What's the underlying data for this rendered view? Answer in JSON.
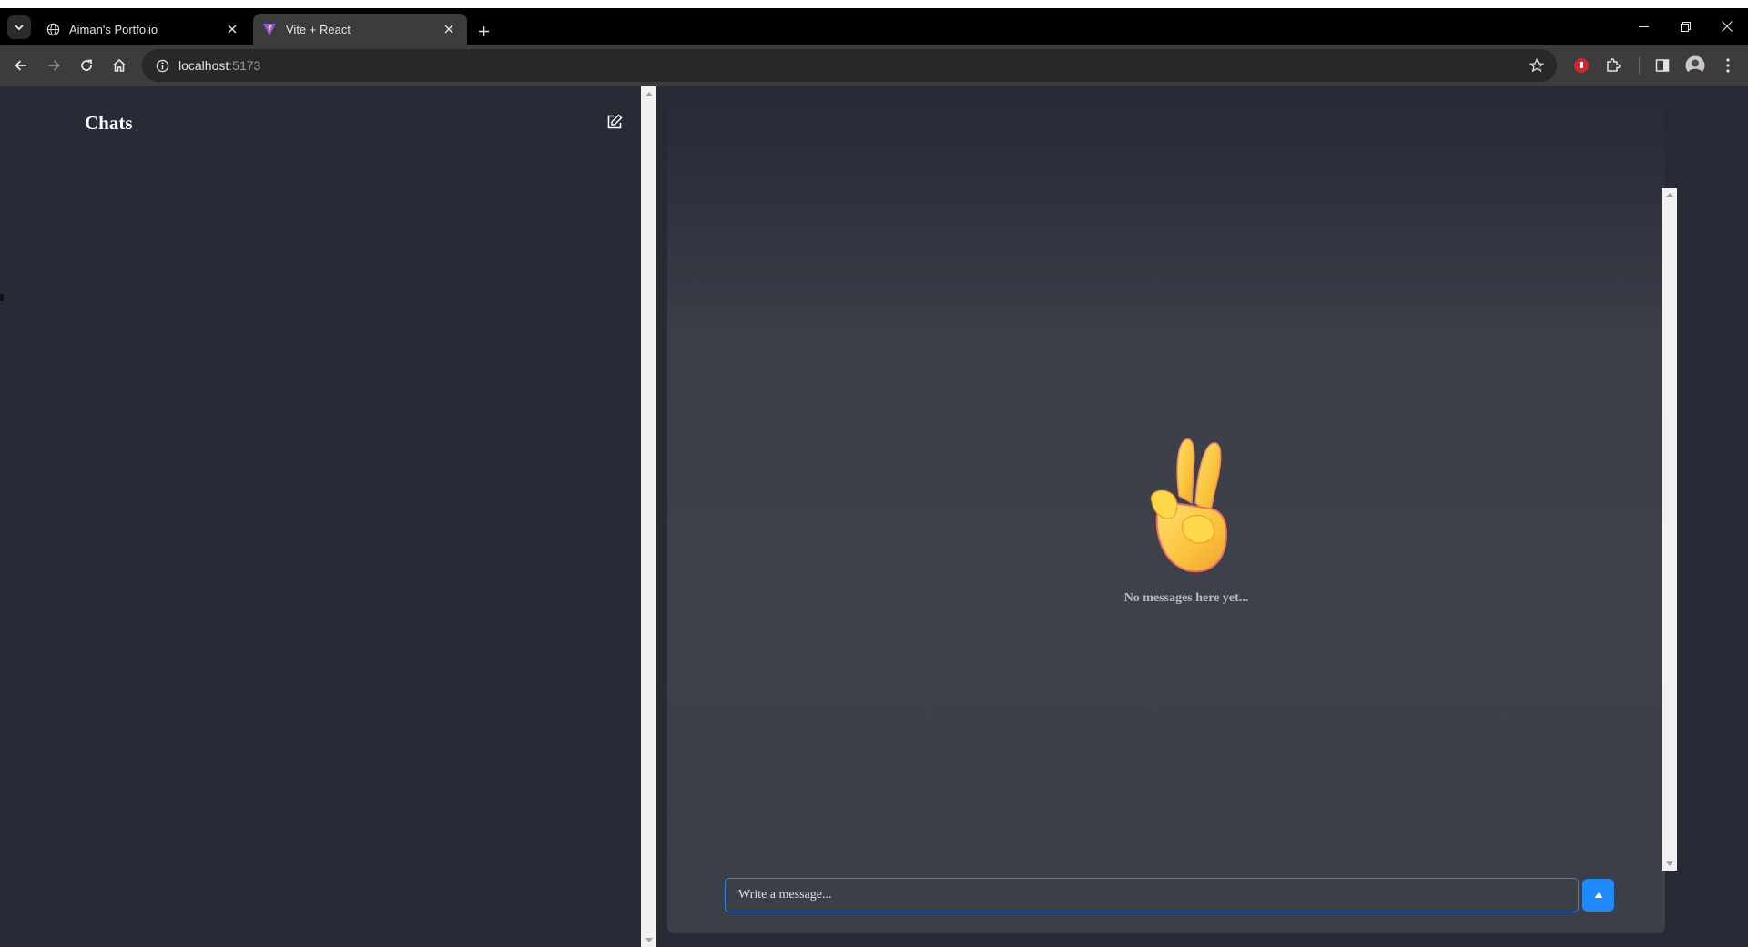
{
  "browser": {
    "tabs": [
      {
        "title": "Aiman's Portfolio",
        "active": false,
        "favicon": "globe-icon"
      },
      {
        "title": "Vite + React",
        "active": true,
        "favicon": "vite-icon"
      }
    ],
    "url": {
      "host": "localhost",
      "port": ":5173"
    }
  },
  "sidebar": {
    "title": "Chats",
    "compose_icon": "edit-icon"
  },
  "chat": {
    "empty_emoji": "victory-hand-emoji",
    "empty_text": "No messages here yet...",
    "input_placeholder": "Write a message...",
    "send_icon": "send-arrow-icon"
  },
  "colors": {
    "sidebar_bg": "#282b36",
    "panel_bg": "#3e404a",
    "accent": "#1e88ff"
  }
}
